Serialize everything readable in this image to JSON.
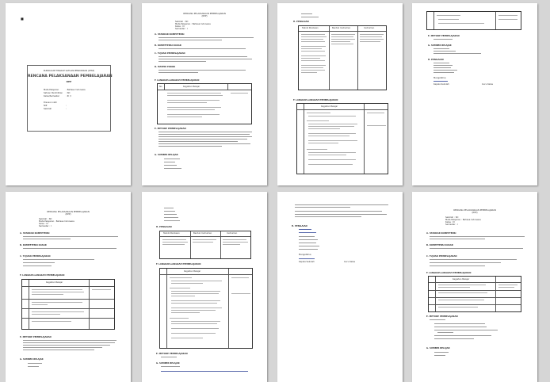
{
  "viewer": {
    "page_count": 8
  },
  "cover": {
    "top_line": "KURIKULUM TINGKAT SATUAN PENDIDIKAN (KTSP)",
    "title": "RENCANA PELAKSANAAN PEMBELAJARAN",
    "abbr": "RPP",
    "fields": [
      {
        "label": "Mata Pelajaran",
        "value": ": Bahasa Indonesia"
      },
      {
        "label": "Satuan Pendidikan",
        "value": ": SD"
      },
      {
        "label": "Kelas/Semester",
        "value": ": III / I"
      },
      {
        "label": "Disusun oleh",
        "value": ""
      },
      {
        "label": "NIP",
        "value": ":"
      },
      {
        "label": "Sekolah",
        "value": ":"
      }
    ]
  },
  "rpp": {
    "header": "RENCANA PELAKSANAAN PEMBELAJARAN",
    "sub": "(RPP)",
    "id_lines": [
      "Sekolah : SD",
      "Mata Pelajaran : Bahasa Indonesia",
      "Kelas : III",
      "Semester : I"
    ],
    "sections": [
      "A. STANDAR KOMPETENSI",
      "B. KOMPETENSI DASAR",
      "C. TUJUAN PEMBELAJARAN",
      "D. MATERI POKOK",
      "E. METODE PEMBELAJARAN",
      "F. LANGKAH-LANGKAH PEMBELAJARAN",
      "G. SUMBER BELAJAR",
      "H. PENILAIAN"
    ],
    "table_header": [
      "No",
      "Kegiatan Belajar",
      "Nilai Budaya dan Karakter Bangsa"
    ],
    "eval_header": [
      "Teknik Penilaian",
      "Bentuk Instrumen",
      "Instrumen"
    ],
    "sign": [
      "Mengetahui,",
      "Kepala Sekolah",
      "Guru Kelas"
    ]
  }
}
